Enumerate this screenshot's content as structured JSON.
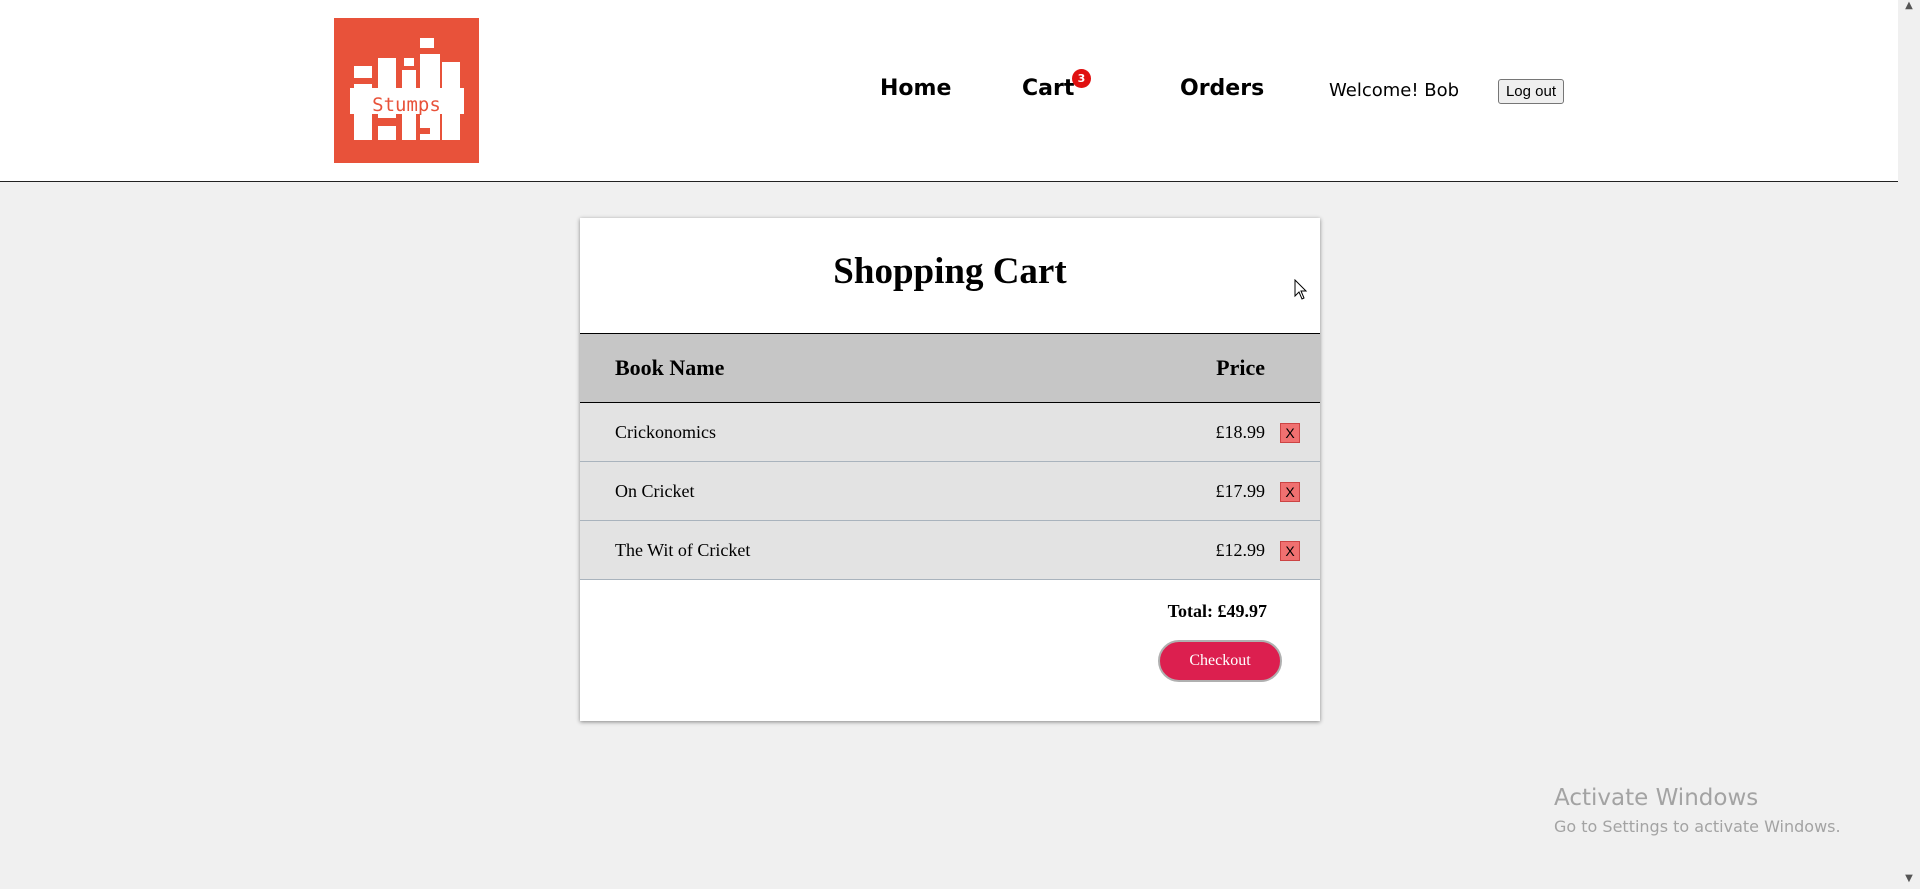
{
  "header": {
    "logo_text": "Stumps",
    "nav": {
      "home": "Home",
      "cart": "Cart",
      "orders": "Orders"
    },
    "cart_count": "3",
    "welcome": "Welcome! Bob",
    "logout_label": "Log out"
  },
  "cart": {
    "title": "Shopping Cart",
    "columns": {
      "name": "Book Name",
      "price": "Price"
    },
    "items": [
      {
        "name": "Crickonomics",
        "price": "£18.99",
        "remove": "X"
      },
      {
        "name": "On Cricket",
        "price": "£17.99",
        "remove": "X"
      },
      {
        "name": "The Wit of Cricket",
        "price": "£12.99",
        "remove": "X"
      }
    ],
    "total": "Total: £49.97",
    "checkout_label": "Checkout"
  },
  "watermark": {
    "title": "Activate Windows",
    "subtitle": "Go to Settings to activate Windows."
  },
  "colors": {
    "logo": "#e8523a",
    "checkout": "#dc1f4f",
    "badge": "#e01010",
    "remove": "#f07070"
  }
}
